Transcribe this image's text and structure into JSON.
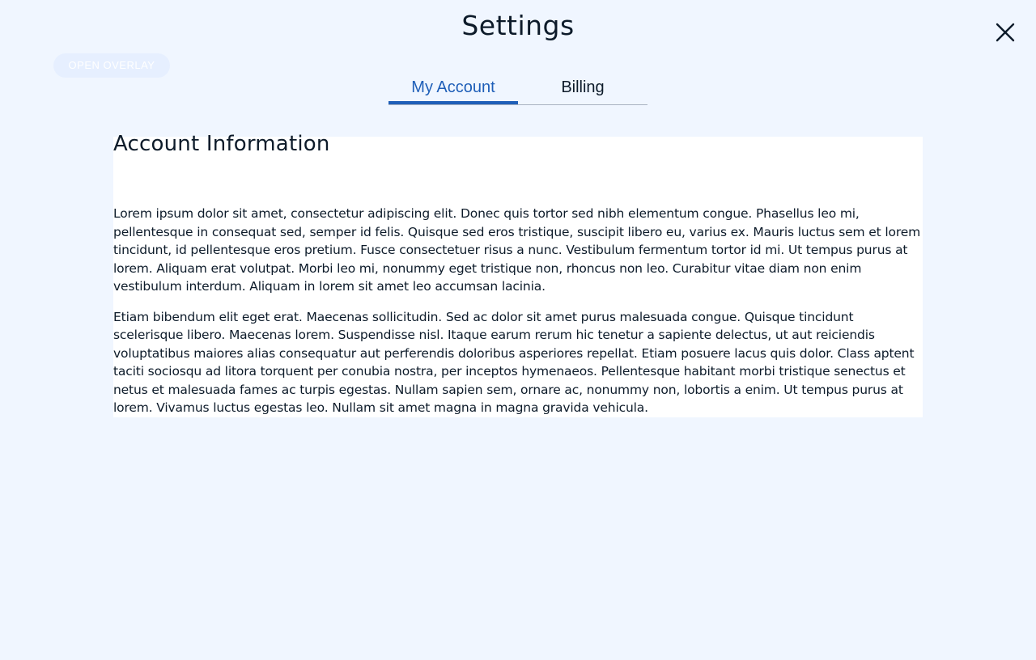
{
  "header": {
    "title": "Settings",
    "close_icon": "close-icon"
  },
  "overlay_button": {
    "label": "OPEN OVERLAY"
  },
  "tabs": [
    {
      "label": "My Account",
      "active": true
    },
    {
      "label": "Billing",
      "active": false
    }
  ],
  "account": {
    "heading": "Account Information",
    "paragraphs": [
      "Lorem ipsum dolor sit amet, consectetur adipiscing elit. Donec quis tortor sed nibh elementum congue. Phasellus leo mi, pellentesque in consequat sed, semper id felis. Quisque sed eros tristique, suscipit libero eu, varius ex. Mauris luctus sem et lorem tincidunt, id pellentesque eros pretium. Fusce consectetuer risus a nunc. Vestibulum fermentum tortor id mi. Ut tempus purus at lorem. Aliquam erat volutpat. Morbi leo mi, nonummy eget tristique non, rhoncus non leo. Curabitur vitae diam non enim vestibulum interdum. Aliquam in lorem sit amet leo accumsan lacinia.",
      "Etiam bibendum elit eget erat. Maecenas sollicitudin. Sed ac dolor sit amet purus malesuada congue. Quisque tincidunt scelerisque libero. Maecenas lorem. Suspendisse nisl. Itaque earum rerum hic tenetur a sapiente delectus, ut aut reiciendis voluptatibus maiores alias consequatur aut perferendis doloribus asperiores repellat. Etiam posuere lacus quis dolor. Class aptent taciti sociosqu ad litora torquent per conubia nostra, per inceptos hymenaeos. Pellentesque habitant morbi tristique senectus et netus et malesuada fames ac turpis egestas. Nullam sapien sem, ornare ac, nonummy non, lobortis a enim. Ut tempus purus at lorem. Vivamus luctus egestas leo. Nullam sit amet magna in magna gravida vehicula."
    ]
  },
  "colors": {
    "background": "#f0f6ff",
    "accent": "#1f5fb8",
    "text": "#0d1b2a"
  }
}
